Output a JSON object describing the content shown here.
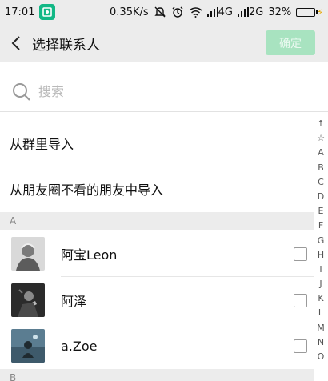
{
  "status_bar": {
    "time": "17:01",
    "net_speed": "0.35K/s",
    "signal1_label": "4G",
    "signal2_label": "2G",
    "battery_percent": "32%",
    "battery_level": 0.32
  },
  "header": {
    "title": "选择联系人",
    "confirm_label": "确定"
  },
  "search": {
    "placeholder": "搜索"
  },
  "imports": [
    {
      "label": "从群里导入"
    },
    {
      "label": "从朋友圈不看的朋友中导入"
    }
  ],
  "sections": [
    {
      "letter": "A"
    },
    {
      "letter": "B"
    }
  ],
  "contacts": [
    {
      "name": "阿宝Leon",
      "checked": false
    },
    {
      "name": "阿泽",
      "checked": false
    },
    {
      "name": "a.Zoe",
      "checked": false
    }
  ],
  "index": [
    "↑",
    "☆",
    "A",
    "B",
    "C",
    "D",
    "E",
    "F",
    "G",
    "H",
    "I",
    "J",
    "K",
    "L",
    "M",
    "N",
    "O"
  ]
}
